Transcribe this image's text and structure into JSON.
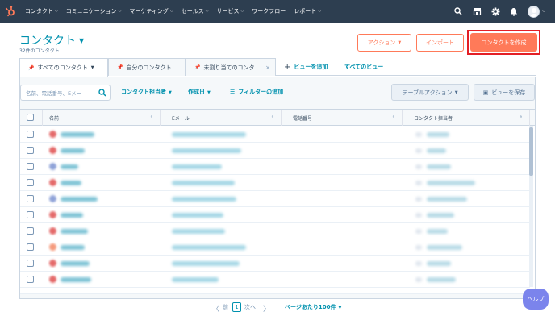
{
  "nav": {
    "items": [
      "コンタクト",
      "コミュニケーション",
      "マーケティング",
      "セールス",
      "サービス",
      "ワークフロー",
      "レポート"
    ],
    "has_caret": [
      true,
      true,
      true,
      true,
      true,
      false,
      true
    ],
    "accent": "#ff7a59",
    "bg": "#2d3e50"
  },
  "header": {
    "title": "コンタクト",
    "count": "32件のコンタクト",
    "actions_label": "アクション",
    "import_label": "インポート",
    "create_label": "コンタクトを作成"
  },
  "tabs": {
    "all": "すべてのコンタクト",
    "mine": "自分のコンタクト",
    "unassigned": "未割り当てのコンタ...",
    "add_view": "ビューを追加",
    "all_views": "すべてのビュー"
  },
  "filters": {
    "search_placeholder": "名前、電話番号、Eメー",
    "owner": "コンタクト担当者",
    "created": "作成日",
    "more": "フィルターの追加",
    "table_actions": "テーブルアクション",
    "save_view": "ビューを保存"
  },
  "table": {
    "columns": [
      "名前",
      "Eメール",
      "電話番号",
      "コンタクト担当者"
    ],
    "row_count": 10,
    "avatar_colors": [
      "#e46969",
      "#e46969",
      "#8fa3d8",
      "#e46969",
      "#8fa3d8",
      "#e46969",
      "#e46969",
      "#f59a7c",
      "#e46969",
      "#e46969"
    ]
  },
  "pagination": {
    "prev": "〈",
    "prev_label": "前",
    "page": "1",
    "next_label": "次へ",
    "next": "〉",
    "per_page": "ページあたり100件"
  },
  "help": {
    "label": "ヘルプ"
  }
}
